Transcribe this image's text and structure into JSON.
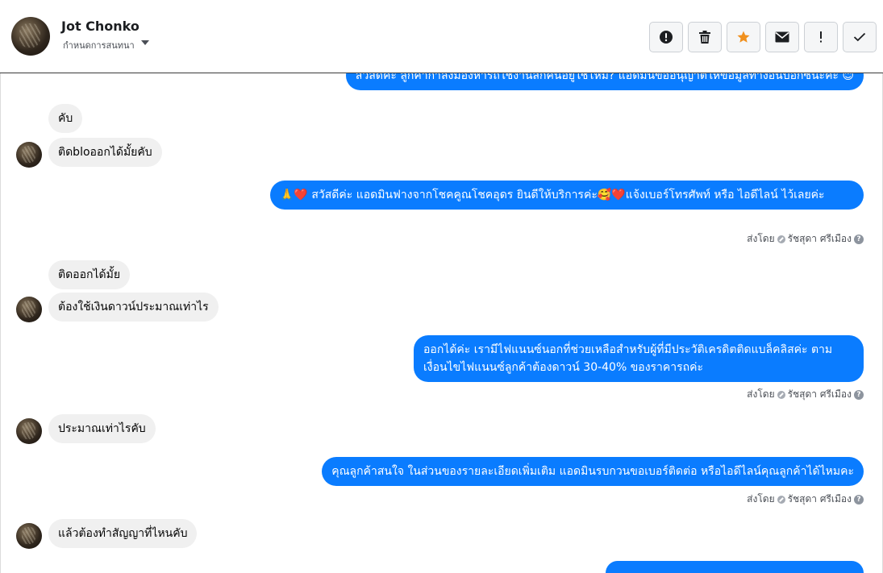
{
  "header": {
    "name": "Jot Chonko",
    "subtitle": "กำหนดการสนทนา",
    "actions": [
      {
        "icon": "alert-circle-icon"
      },
      {
        "icon": "trash-icon"
      },
      {
        "icon": "star-icon",
        "color": "#f0901e"
      },
      {
        "icon": "envelope-icon"
      },
      {
        "icon": "exclamation-icon"
      },
      {
        "icon": "checkmark-icon"
      }
    ]
  },
  "messages": {
    "m0_out": "สวัสดีค่ะ ลูกค้ากำลังมองหารถใช้งานสักคันอยู่ใช่ไหม? แอดมินขออนุญาตให้ข้อมูลทางอินบ็อกซ์นะคะ 😊",
    "m1_in": "คับ",
    "m2_in": "ติดbloออกได้มั้ยคับ",
    "m3_out": "🙏❤️ สวัสดีค่ะ แอดมินฟางจากโชคคูณโชคอุดร ยินดีให้บริการค่ะ🥰❤️แจ้งเบอร์โทรศัพท์ หรือ ไอดีไลน์  ไว้เลยค่ะ",
    "m4_in": "ติดออกได้มั้ย",
    "m5_in": "ต้องใช้เงินดาวน์ประมาณเท่าไร",
    "m6_out": "ออกได้ค่ะ เรามีไฟแนนซ์นอกที่ช่วยเหลือสำหรับผู้ที่มีประวัติเครดิตติดแบล็คลิสค่ะ ตามเงื่อนไขไฟแนนซ์ลูกค้าต้องดาวน์ 30-40% ของราคารถค่ะ",
    "m7_in": "ประมาณเท่าไรคับ",
    "m8_out": "คุณลูกค้าสนใจ ในส่วนของรายละเอียดเพิ่มเติม แอดมินรบกวนขอเบอร์ติดต่อ หรือไอดีไลน์คุณลูกค้าได้ไหมคะ",
    "m9_in": "แล้วต้องทำสัญญาที่ไหนคับ"
  },
  "sent_by": {
    "prefix": "ส่งโดย",
    "agent": "รัชสุดา ศรีเมือง",
    "help": "?"
  },
  "colors": {
    "outgoing_bubble": "#0a7cff",
    "incoming_bubble": "#f0f0f0",
    "star": "#f0901e"
  }
}
